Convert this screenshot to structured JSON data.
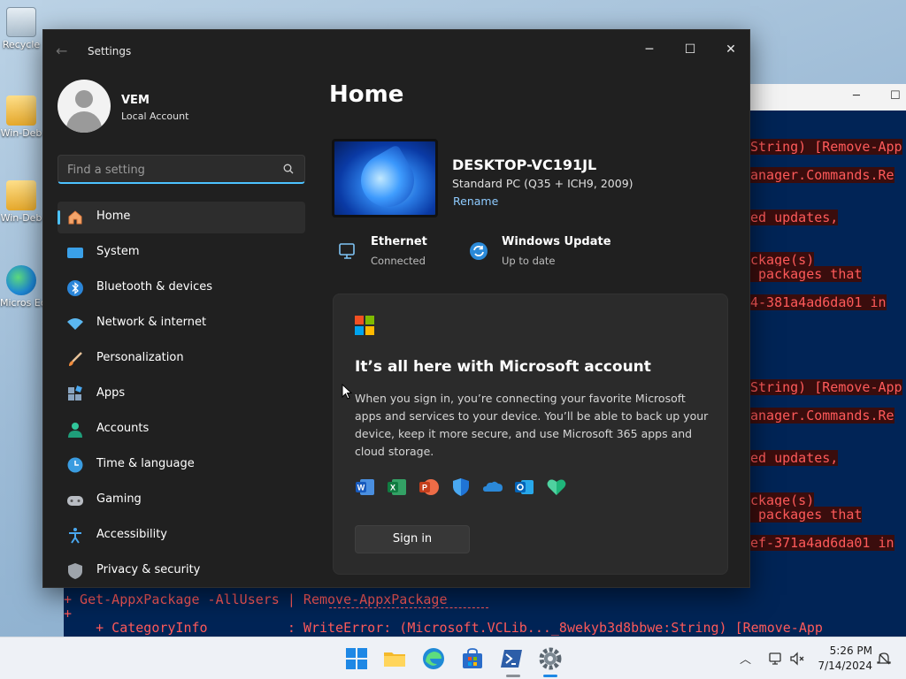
{
  "desktop": {
    "icons": [
      {
        "label": "Recycle"
      },
      {
        "label": "Win-Deb"
      },
      {
        "label": "Win-Deb"
      },
      {
        "label": "Micros Edg"
      }
    ]
  },
  "terminal": {
    "lines": [
      "String) [Remove-App",
      "anager.Commands.Re",
      "ed updates,",
      "ckage(s)",
      " packages that",
      "4-381a4ad6da01 in",
      "String) [Remove-App",
      "anager.Commands.Re",
      "ed updates,",
      "ckage(s)",
      " packages that",
      "ef-371a4ad6da01 in",
      "+ Get-AppxPackage -AllUsers | Remove-AppxPackage",
      "+",
      "    + CategoryInfo          : WriteError: (Microsoft.VCLib..._8wekyb3d8bbwe:String) [Remove-App"
    ]
  },
  "window": {
    "title": "Settings",
    "controls": {
      "minimize": "─",
      "maximize": "☐",
      "close": "✕"
    }
  },
  "profile": {
    "name": "VEM",
    "account_type": "Local Account"
  },
  "search": {
    "placeholder": "Find a setting"
  },
  "nav": {
    "items": [
      {
        "label": "Home",
        "icon": "home-icon",
        "active": true
      },
      {
        "label": "System",
        "icon": "system-icon"
      },
      {
        "label": "Bluetooth & devices",
        "icon": "bluetooth-icon"
      },
      {
        "label": "Network & internet",
        "icon": "network-icon"
      },
      {
        "label": "Personalization",
        "icon": "brush-icon"
      },
      {
        "label": "Apps",
        "icon": "apps-icon"
      },
      {
        "label": "Accounts",
        "icon": "accounts-icon"
      },
      {
        "label": "Time & language",
        "icon": "clock-icon"
      },
      {
        "label": "Gaming",
        "icon": "gamepad-icon"
      },
      {
        "label": "Accessibility",
        "icon": "accessibility-icon"
      },
      {
        "label": "Privacy & security",
        "icon": "shield-icon"
      }
    ]
  },
  "main": {
    "title": "Home",
    "device": {
      "name": "DESKTOP-VC191JL",
      "spec": "Standard PC (Q35 + ICH9, 2009)",
      "rename": "Rename"
    },
    "status": [
      {
        "title": "Ethernet",
        "sub": "Connected",
        "icon": "ethernet-icon"
      },
      {
        "title": "Windows Update",
        "sub": "Up to date",
        "icon": "windows-update-icon"
      }
    ],
    "card": {
      "title": "It’s all here with Microsoft account",
      "description": "When you sign in, you’re connecting your favorite Microsoft apps and services to your device. You’ll be able to back up your device, keep it more secure, and use Microsoft 365 apps and cloud storage.",
      "apps": [
        "word-icon",
        "excel-icon",
        "powerpoint-icon",
        "defender-icon",
        "onedrive-icon",
        "outlook-icon",
        "family-icon"
      ],
      "signin_label": "Sign in"
    }
  },
  "taskbar": {
    "clock_time": "5:26 PM",
    "clock_date": "7/14/2024"
  },
  "colors": {
    "accent": "#4cc2ff",
    "window_bg": "#202020",
    "card_bg": "#2b2b2b",
    "terminal_bg": "#012456",
    "error_text": "#ff5a5a"
  }
}
